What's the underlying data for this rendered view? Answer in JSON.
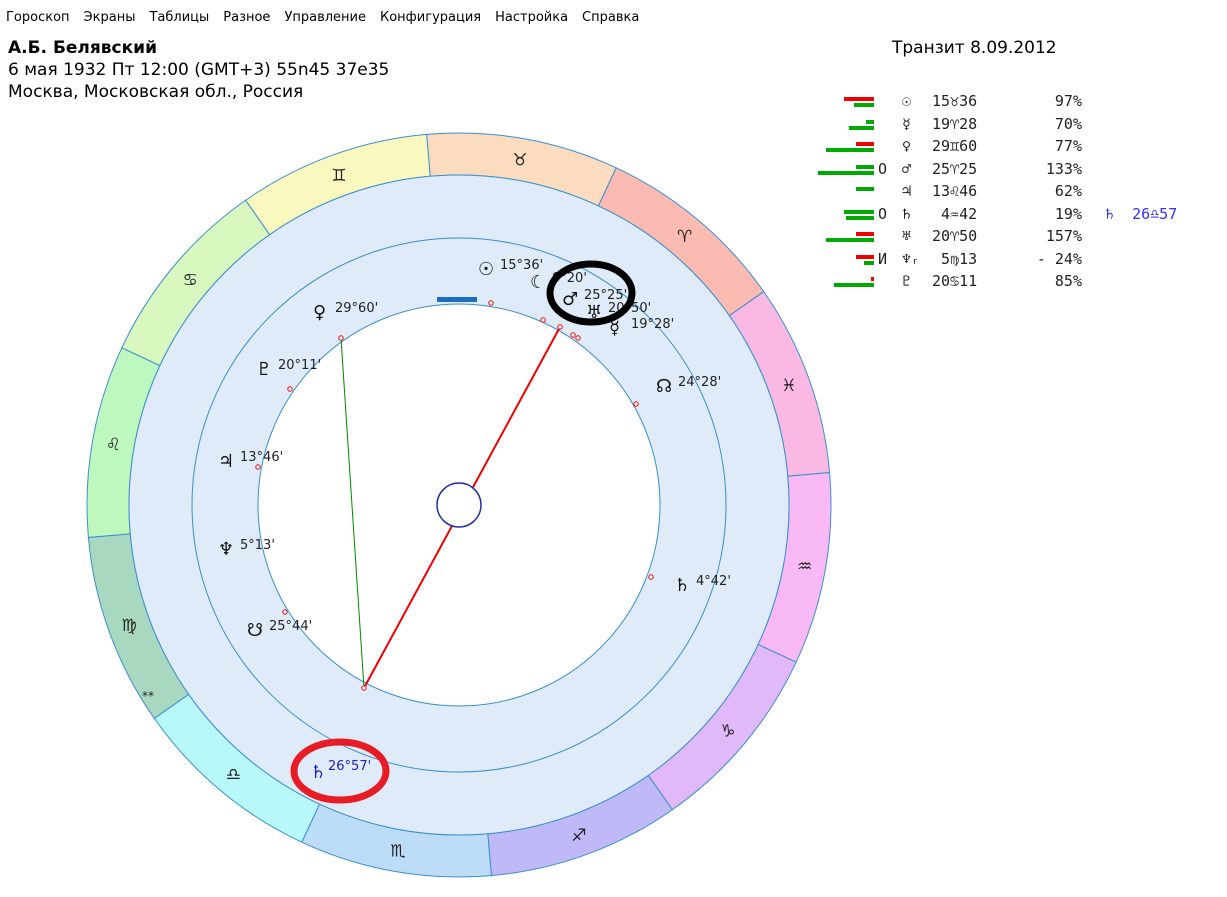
{
  "menu": [
    "Гороскоп",
    "Экраны",
    "Таблицы",
    "Разное",
    "Управление",
    "Конфигурация",
    "Настройка",
    "Справка"
  ],
  "header": {
    "name": "А.Б. Белявский",
    "birth": "6 мая 1932  Пт  12:00 (GMT+3) 55n45  37e35",
    "place": "Москва, Московская обл., Россия",
    "transit": "Транзит  8.09.2012"
  },
  "table": [
    {
      "glyph": "☉",
      "pos": "15♉36",
      "pct": "97%",
      "mark": "",
      "bars": [
        [
          "#e00",
          30
        ],
        [
          "#0a0",
          20
        ]
      ]
    },
    {
      "glyph": "☿",
      "pos": "19♈28",
      "pct": "70%",
      "mark": "",
      "bars": [
        [
          "#0a0",
          8
        ],
        [
          "#0a0",
          25
        ]
      ]
    },
    {
      "glyph": "♀",
      "pos": "29♊60",
      "pct": "77%",
      "mark": "",
      "bars": [
        [
          "#e00",
          18
        ],
        [
          "#0a0",
          48
        ]
      ]
    },
    {
      "glyph": "♂",
      "pos": "25♈25",
      "pct": "133%",
      "mark": "O",
      "bars": [
        [
          "#0a0",
          18
        ],
        [
          "#0a0",
          56
        ]
      ]
    },
    {
      "glyph": "♃",
      "pos": "13♌46",
      "pct": "62%",
      "mark": "",
      "bars": [
        [
          "#0a0",
          18
        ]
      ]
    },
    {
      "glyph": "♄",
      "pos": " 4♒42",
      "pct": "19%",
      "mark": "O",
      "bars": [
        [
          "#0a0",
          30
        ],
        [
          "#0a0",
          28
        ]
      ],
      "transit": "♄  26♎57"
    },
    {
      "glyph": "♅",
      "pos": "20♈50",
      "pct": "157%",
      "mark": "",
      "bars": [
        [
          "#e00",
          18
        ],
        [
          "#0a0",
          48
        ]
      ]
    },
    {
      "glyph": "♆ᵣ",
      "pos": " 5♍13",
      "pct": "- 24%",
      "mark": "И",
      "bars": [
        [
          "#e00",
          18
        ],
        [
          "#0a0",
          10
        ]
      ]
    },
    {
      "glyph": "♇",
      "pos": "20♋11",
      "pct": "85%",
      "mark": "",
      "bars": [
        [
          "#e00",
          3
        ],
        [
          "#0a0",
          40
        ]
      ]
    }
  ],
  "signs": [
    {
      "glyph": "♉",
      "color": "#fbdcbf"
    },
    {
      "glyph": "♈",
      "color": "#fbbab2"
    },
    {
      "glyph": "♓",
      "color": "#f9b9e2"
    },
    {
      "glyph": "♒",
      "color": "#f8b9f6"
    },
    {
      "glyph": "♑",
      "color": "#e2b9f8"
    },
    {
      "glyph": "♐",
      "color": "#c0b9f8"
    },
    {
      "glyph": "♏",
      "color": "#bcdcf8"
    },
    {
      "glyph": "♎",
      "color": "#b9f8f8"
    },
    {
      "glyph": "♍",
      "color": "#a9d8c0"
    },
    {
      "glyph": "♌",
      "color": "#bff8bf"
    },
    {
      "glyph": "♋",
      "color": "#d8f8c0"
    },
    {
      "glyph": "♊",
      "color": "#f8f8bf"
    }
  ],
  "natal": [
    {
      "glyph": "☉",
      "label": "15°36'"
    },
    {
      "glyph": "☾",
      "label": "0°20'"
    },
    {
      "glyph": "♂",
      "label": "25°25'"
    },
    {
      "glyph": "♅",
      "label": "20°50'"
    },
    {
      "glyph": "☿",
      "label": "19°28'"
    },
    {
      "glyph": "☊",
      "label": "24°28'"
    },
    {
      "glyph": "♄",
      "label": "4°42'"
    },
    {
      "glyph": "♀",
      "label": "29°60'"
    },
    {
      "glyph": "♇",
      "label": "20°11'"
    },
    {
      "glyph": "♃",
      "label": "13°46'"
    },
    {
      "glyph": "♆",
      "label": "5°13'"
    },
    {
      "glyph": "☋",
      "label": "25°44'"
    }
  ],
  "transit_planet": {
    "glyph": "♄",
    "label": "26°57'"
  },
  "virgo_mark": "**"
}
